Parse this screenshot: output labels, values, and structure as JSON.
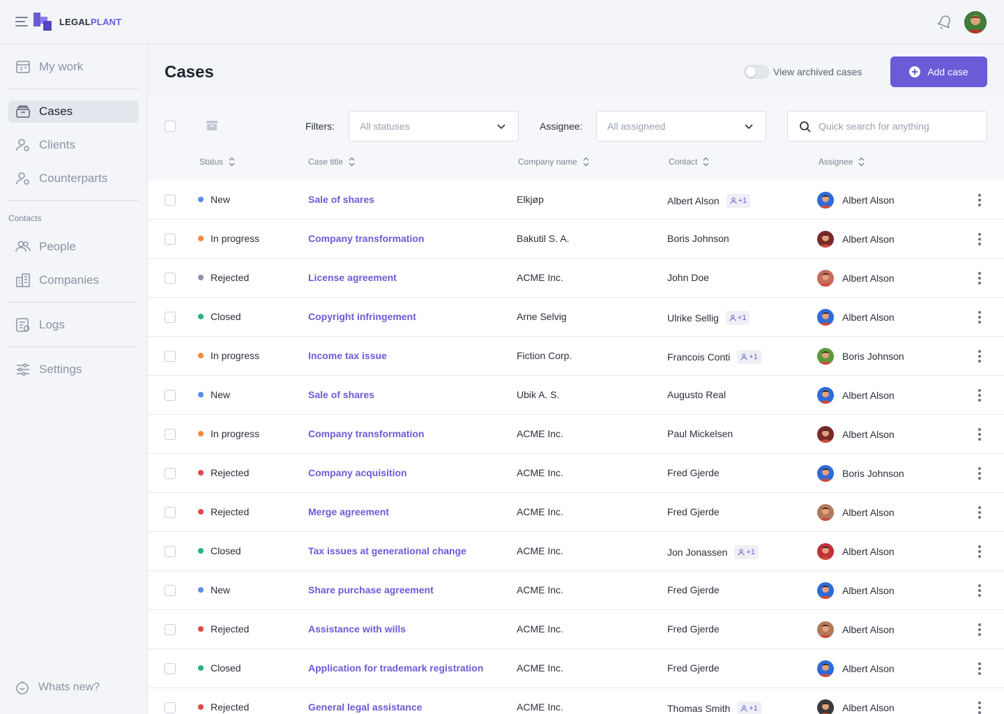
{
  "brand": {
    "name_part1": "LEGAL",
    "name_part2": "PLANT",
    "accent": "#6b5bd6"
  },
  "sidebar": {
    "items": [
      {
        "label": "My work",
        "icon": "calendar-icon"
      },
      {
        "label": "Cases",
        "icon": "archive-icon"
      },
      {
        "label": "Clients",
        "icon": "user-settings-icon"
      },
      {
        "label": "Counterparts",
        "icon": "user-settings-icon"
      },
      {
        "label": "People",
        "icon": "people-icon"
      },
      {
        "label": "Companies",
        "icon": "buildings-icon"
      },
      {
        "label": "Logs",
        "icon": "logs-icon"
      },
      {
        "label": "Settings",
        "icon": "sliders-icon"
      }
    ],
    "active": "Cases",
    "section_contacts": "Contacts",
    "whats_new": "Whats new?"
  },
  "page": {
    "title": "Cases",
    "archived_toggle_label": "View archived cases",
    "add_button_label": "Add case"
  },
  "filters": {
    "filters_label": "Filters:",
    "status_placeholder": "All statuses",
    "assignee_label": "Assignee:",
    "assignee_placeholder": "All assigneed",
    "search_placeholder": "Quick search for anything"
  },
  "table": {
    "columns": [
      "Status",
      "Case title",
      "Company name",
      "Contact",
      "Assignee"
    ],
    "status_colors": {
      "New": "#5b8def",
      "In progress": "#f5883a",
      "Rejected": "#8e95a6",
      "Closed": "#24b47e",
      "RejectedRed": "#e5484d"
    },
    "rows": [
      {
        "status": "New",
        "color": "#5b8def",
        "title": "Sale of shares",
        "company": "Elkjøp",
        "contact": "Albert Alson",
        "extra": "+1",
        "assignee": "Albert Alson",
        "av": "#2e6bd8"
      },
      {
        "status": "In progress",
        "color": "#f5883a",
        "title": "Company transformation",
        "company": "Bakutil S. A.",
        "contact": "Boris Johnson",
        "extra": "",
        "assignee": "Albert Alson",
        "av": "#7a2a2a"
      },
      {
        "status": "Rejected",
        "color": "#8e95a6",
        "title": "License agreement",
        "company": "ACME Inc.",
        "contact": "John Doe",
        "extra": "",
        "assignee": "Albert Alson",
        "av": "#c46b5a"
      },
      {
        "status": "Closed",
        "color": "#24b47e",
        "title": "Copyright infringement",
        "company": "Arne Selvig",
        "contact": "Ulrike Sellig",
        "extra": "+1",
        "assignee": "Albert Alson",
        "av": "#2e6bd8"
      },
      {
        "status": "In progress",
        "color": "#f5883a",
        "title": "Income tax issue",
        "company": "Fiction Corp.",
        "contact": "Francois Conti",
        "extra": "+1",
        "assignee": "Boris Johnson",
        "av": "#5b9a3a"
      },
      {
        "status": "New",
        "color": "#5b8def",
        "title": "Sale of shares",
        "company": "Ubik A. S.",
        "contact": "Augusto Real",
        "extra": "",
        "assignee": "Albert Alson",
        "av": "#2e6bd8"
      },
      {
        "status": "In progress",
        "color": "#f5883a",
        "title": "Company transformation",
        "company": "ACME Inc.",
        "contact": "Paul Mickelsen",
        "extra": "",
        "assignee": "Albert Alson",
        "av": "#7a2a2a"
      },
      {
        "status": "Rejected",
        "color": "#e5484d",
        "title": "Company acquisition",
        "company": "ACME Inc.",
        "contact": "Fred Gjerde",
        "extra": "",
        "assignee": "Boris Johnson",
        "av": "#2e6bd8"
      },
      {
        "status": "Rejected",
        "color": "#e5484d",
        "title": "Merge agreement",
        "company": "ACME Inc.",
        "contact": "Fred Gjerde",
        "extra": "",
        "assignee": "Albert Alson",
        "av": "#b07a5a"
      },
      {
        "status": "Closed",
        "color": "#24b47e",
        "title": "Tax issues at generational change",
        "company": "ACME Inc.",
        "contact": "Jon Jonassen",
        "extra": "+1",
        "assignee": "Albert Alson",
        "av": "#c0303a"
      },
      {
        "status": "New",
        "color": "#5b8def",
        "title": "Share purchase agreement",
        "company": "ACME Inc.",
        "contact": "Fred Gjerde",
        "extra": "",
        "assignee": "Albert Alson",
        "av": "#2e6bd8"
      },
      {
        "status": "Rejected",
        "color": "#e5484d",
        "title": "Assistance with wills",
        "company": "ACME Inc.",
        "contact": "Fred Gjerde",
        "extra": "",
        "assignee": "Albert Alson",
        "av": "#b07a5a"
      },
      {
        "status": "Closed",
        "color": "#24b47e",
        "title": "Application for trademark registration",
        "company": "ACME Inc.",
        "contact": "Fred Gjerde",
        "extra": "",
        "assignee": "Albert Alson",
        "av": "#2e6bd8"
      },
      {
        "status": "Rejected",
        "color": "#e5484d",
        "title": "General legal assistance",
        "company": "ACME Inc.",
        "contact": "Thomas Smith",
        "extra": "+1",
        "assignee": "Albert Alson",
        "av": "#3a3a3a"
      }
    ]
  }
}
